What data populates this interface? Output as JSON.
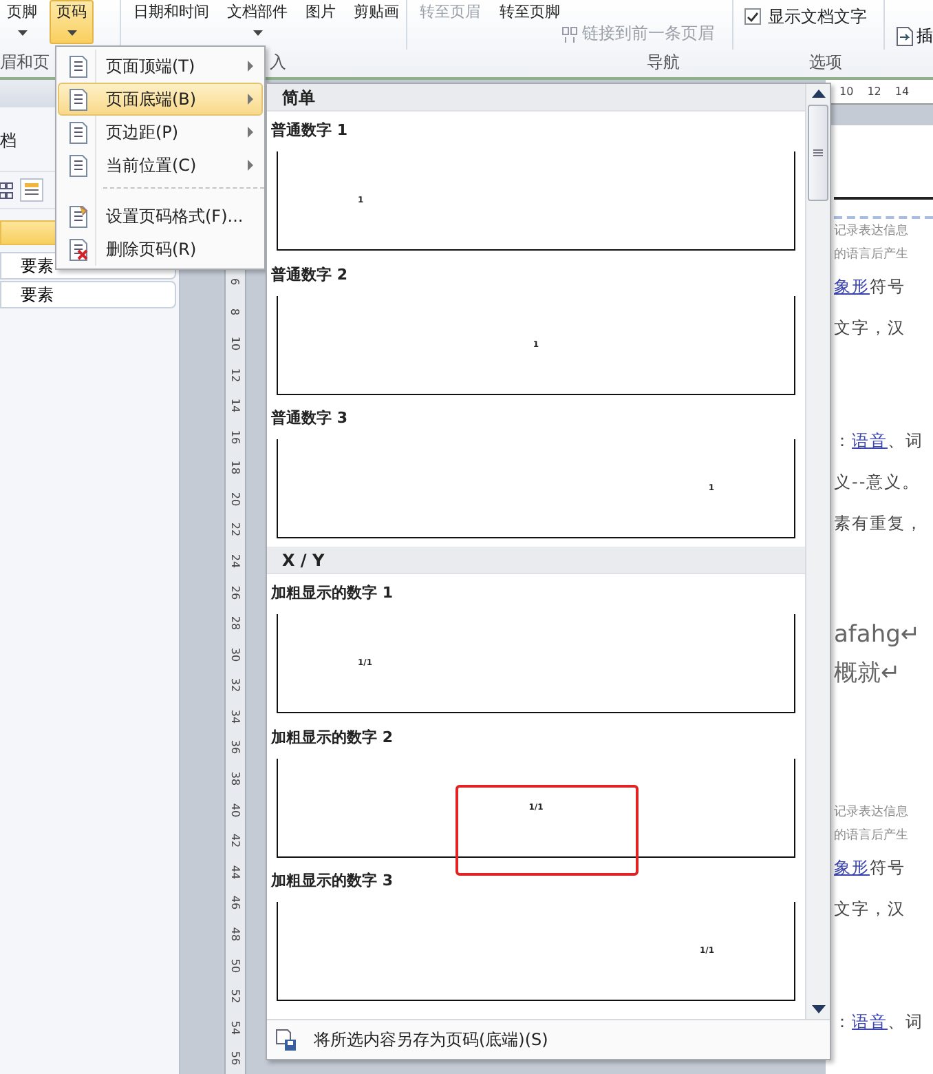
{
  "ribbon": {
    "buttons": [
      {
        "label": "页脚",
        "dropdown": true,
        "selected": false,
        "disabled": false
      },
      {
        "label": "页码",
        "dropdown": true,
        "selected": true,
        "disabled": false
      },
      {
        "label": "日期和时间",
        "dropdown": false,
        "selected": false,
        "disabled": false
      },
      {
        "label": "文档部件",
        "dropdown": true,
        "selected": false,
        "disabled": false
      },
      {
        "label": "图片",
        "dropdown": false,
        "selected": false,
        "disabled": false
      },
      {
        "label": "剪贴画",
        "dropdown": false,
        "selected": false,
        "disabled": false
      },
      {
        "label": "转至页眉",
        "dropdown": false,
        "selected": false,
        "disabled": true
      },
      {
        "label": "转至页脚",
        "dropdown": false,
        "selected": false,
        "disabled": false
      }
    ],
    "link_button": {
      "label": "链接到前一条页眉",
      "disabled": true
    },
    "checkbox": {
      "label": "显示文档文字",
      "checked": true
    },
    "groups": [
      "眉和页",
      "入",
      "导航",
      "选项"
    ],
    "cut_button": "插"
  },
  "nav": {
    "title": "档",
    "items": [
      {
        "selected": true
      },
      {
        "label": "要素",
        "selected": false
      },
      {
        "label": "要素",
        "selected": false
      }
    ]
  },
  "menu": {
    "items": [
      {
        "kind": "submenu",
        "label": "页面顶端(T)",
        "selected": false
      },
      {
        "kind": "submenu",
        "label": "页面底端(B)",
        "selected": true
      },
      {
        "kind": "submenu",
        "label": "页边距(P)",
        "selected": false
      },
      {
        "kind": "submenu",
        "label": "当前位置(C)",
        "selected": false
      },
      {
        "kind": "command",
        "label": "设置页码格式(F)...",
        "selected": false
      },
      {
        "kind": "command",
        "label": "删除页码(R)",
        "selected": false
      }
    ]
  },
  "gallery": {
    "sections": [
      {
        "title": "简单",
        "items": [
          {
            "title": "普通数字 1",
            "number": "1",
            "kind": "left",
            "highlighted": false
          },
          {
            "title": "普通数字 2",
            "number": "1",
            "kind": "center",
            "highlighted": false
          },
          {
            "title": "普通数字 3",
            "number": "1",
            "kind": "right",
            "highlighted": false
          }
        ]
      },
      {
        "title": "X / Y",
        "items": [
          {
            "title": "加粗显示的数字 1",
            "number": "1/1",
            "kind": "left",
            "highlighted": false
          },
          {
            "title": "加粗显示的数字 2",
            "number": "1/1",
            "kind": "center",
            "highlighted": true
          },
          {
            "title": "加粗显示的数字 3",
            "number": "1/1",
            "kind": "right",
            "highlighted": false
          }
        ]
      }
    ],
    "footer": "将所选内容另存为页码(底端)(S)"
  },
  "vertical_ruler": [
    "6",
    "8",
    "10",
    "12",
    "14",
    "16",
    "18",
    "20",
    "22",
    "24",
    "26",
    "28",
    "30",
    "32",
    "34",
    "36",
    "38",
    "40",
    "42",
    "44",
    "46",
    "48",
    "50",
    "52",
    "54",
    "56"
  ],
  "top_ruler": [
    "10",
    "12",
    "14"
  ],
  "document": {
    "lines": [
      {
        "kind": "small",
        "parts": [
          {
            "text": "记录表达信息",
            "link": false
          }
        ]
      },
      {
        "kind": "small",
        "parts": [
          {
            "text": "的语言后产生",
            "link": false
          }
        ]
      },
      {
        "kind": "body",
        "parts": [
          {
            "text": "象形",
            "link": true
          },
          {
            "text": "符号",
            "link": false
          }
        ]
      },
      {
        "kind": "body",
        "parts": [
          {
            "text": "文字，汉",
            "link": false
          }
        ]
      },
      {
        "kind": "blank"
      },
      {
        "kind": "blank"
      },
      {
        "kind": "body",
        "parts": [
          {
            "text": "：",
            "link": false
          },
          {
            "text": "语音",
            "link": true
          },
          {
            "text": "、词",
            "link": false
          }
        ]
      },
      {
        "kind": "body",
        "parts": [
          {
            "text": "义--意义。",
            "link": false
          }
        ]
      },
      {
        "kind": "body",
        "parts": [
          {
            "text": "素有重复，",
            "link": false
          }
        ]
      },
      {
        "kind": "blank"
      },
      {
        "kind": "blank"
      },
      {
        "kind": "heading",
        "parts": [
          {
            "text": "afahg↵",
            "link": false
          }
        ]
      },
      {
        "kind": "heading",
        "parts": [
          {
            "text": "概就↵",
            "link": false
          }
        ]
      },
      {
        "kind": "blank"
      },
      {
        "kind": "blank"
      },
      {
        "kind": "blank"
      },
      {
        "kind": "small",
        "parts": [
          {
            "text": "记录表达信息",
            "link": false
          }
        ]
      },
      {
        "kind": "small",
        "parts": [
          {
            "text": "的语言后产生",
            "link": false
          }
        ]
      },
      {
        "kind": "body",
        "parts": [
          {
            "text": "象形",
            "link": true
          },
          {
            "text": "符号",
            "link": false
          }
        ]
      },
      {
        "kind": "body",
        "parts": [
          {
            "text": "文字，汉",
            "link": false
          }
        ]
      },
      {
        "kind": "blank"
      },
      {
        "kind": "blank"
      },
      {
        "kind": "body",
        "parts": [
          {
            "text": "：",
            "link": false
          },
          {
            "text": "语音",
            "link": true
          },
          {
            "text": "、词",
            "link": false
          }
        ]
      }
    ]
  }
}
